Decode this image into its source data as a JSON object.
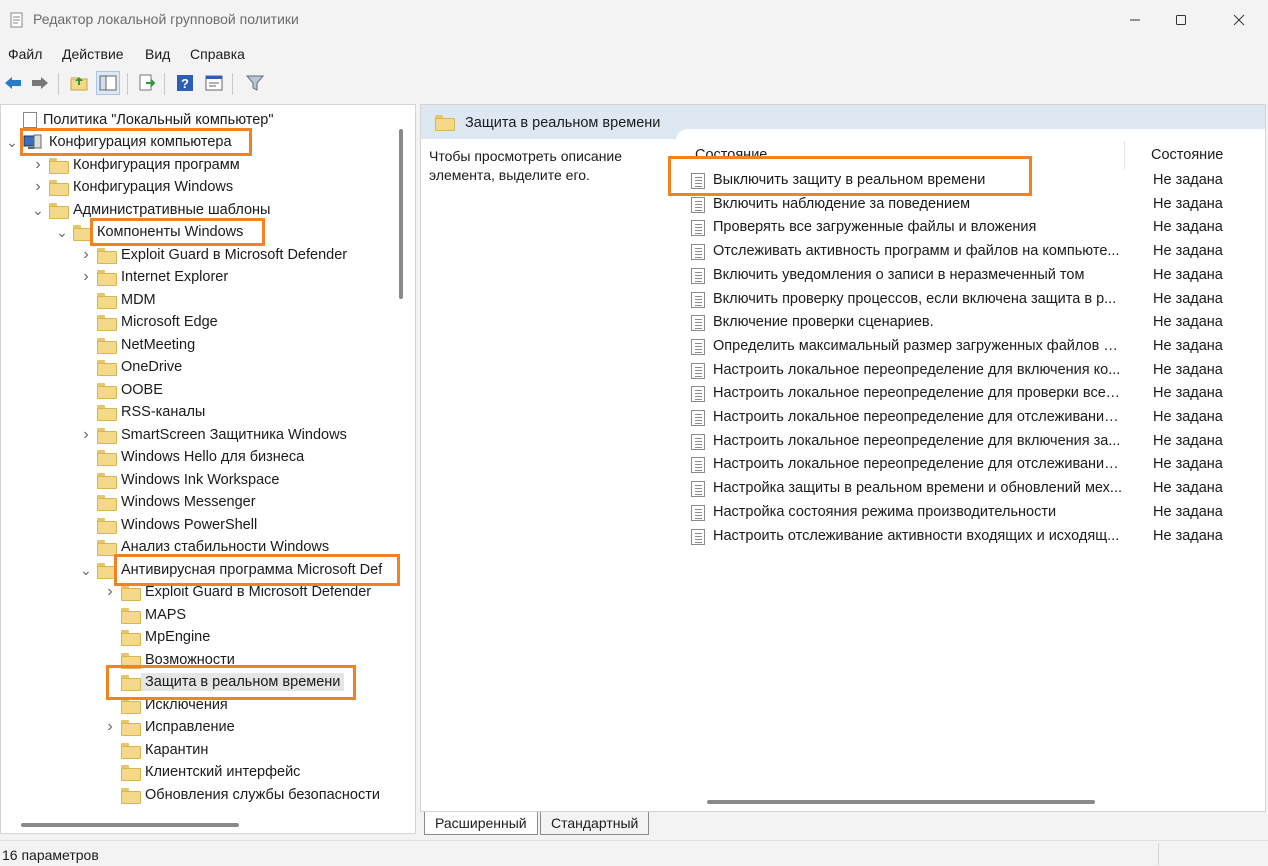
{
  "window": {
    "title": "Редактор локальной групповой политики",
    "controls": [
      "minimize-icon",
      "maximize-icon",
      "close-icon"
    ]
  },
  "menu": {
    "file": "Файл",
    "action": "Действие",
    "view": "Вид",
    "help": "Справка"
  },
  "toolbar": {
    "buttons": [
      "back-icon",
      "forward-icon",
      "up-folder-icon",
      "show-hide-tree-icon",
      "export-list-icon",
      "help-icon",
      "properties-icon",
      "filter-icon"
    ]
  },
  "tree": {
    "items": [
      {
        "label": "Политика \"Локальный компьютер\"",
        "icon": "policy-doc-icon"
      },
      {
        "label": "Конфигурация компьютера",
        "icon": "computer-icon"
      },
      {
        "label": "Конфигурация программ"
      },
      {
        "label": "Конфигурация Windows"
      },
      {
        "label": "Административные шаблоны"
      },
      {
        "label": "Компоненты Windows"
      },
      {
        "label": "Exploit Guard в Microsoft Defender"
      },
      {
        "label": "Internet Explorer"
      },
      {
        "label": "MDM"
      },
      {
        "label": "Microsoft Edge"
      },
      {
        "label": "NetMeeting"
      },
      {
        "label": "OneDrive"
      },
      {
        "label": "OOBE"
      },
      {
        "label": "RSS-каналы"
      },
      {
        "label": "SmartScreen Защитника Windows"
      },
      {
        "label": "Windows Hello для бизнеса"
      },
      {
        "label": "Windows Ink Workspace"
      },
      {
        "label": "Windows Messenger"
      },
      {
        "label": "Windows PowerShell"
      },
      {
        "label": "Анализ стабильности Windows"
      },
      {
        "label": "Антивирусная программа Microsoft Def"
      },
      {
        "label": "Exploit Guard в Microsoft Defender"
      },
      {
        "label": "MAPS"
      },
      {
        "label": "MpEngine"
      },
      {
        "label": "Возможности"
      },
      {
        "label": "Защита в реальном времени"
      },
      {
        "label": "Исключения"
      },
      {
        "label": "Исправление"
      },
      {
        "label": "Карантин"
      },
      {
        "label": "Клиентский интерфейс"
      },
      {
        "label": "Обновления службы безопасности"
      }
    ]
  },
  "content": {
    "header_title": "Защита в реальном времени",
    "description": "Чтобы просмотреть описание элемента, выделите его.",
    "columns": {
      "name": "Состояние",
      "state": "Состояние"
    },
    "rows": [
      {
        "name": "Выключить защиту в реальном времени",
        "state": "Не задана"
      },
      {
        "name": "Включить наблюдение за поведением",
        "state": "Не задана"
      },
      {
        "name": "Проверять все загруженные файлы и вложения",
        "state": "Не задана"
      },
      {
        "name": "Отслеживать активность программ и файлов на компьюте...",
        "state": "Не задана"
      },
      {
        "name": "Включить уведомления о записи в неразмеченный том",
        "state": "Не задана"
      },
      {
        "name": "Включить проверку процессов, если включена защита в р...",
        "state": "Не задана"
      },
      {
        "name": "Включение проверки сценариев.",
        "state": "Не задана"
      },
      {
        "name": "Определить максимальный размер загруженных файлов и...",
        "state": "Не задана"
      },
      {
        "name": "Настроить локальное переопределение для включения ко...",
        "state": "Не задана"
      },
      {
        "name": "Настроить локальное переопределение для проверки всех...",
        "state": "Не задана"
      },
      {
        "name": "Настроить локальное переопределение для отслеживания...",
        "state": "Не задана"
      },
      {
        "name": "Настроить локальное переопределение для включения за...",
        "state": "Не задана"
      },
      {
        "name": "Настроить локальное переопределение для отслеживания...",
        "state": "Не задана"
      },
      {
        "name": "Настройка защиты в реальном времени и обновлений мех...",
        "state": "Не задана"
      },
      {
        "name": "Настройка состояния режима производительности",
        "state": "Не задана"
      },
      {
        "name": "Настроить отслеживание активности входящих и исходящ...",
        "state": "Не задана"
      }
    ]
  },
  "tabs": {
    "extended": "Расширенный",
    "standard": "Стандартный"
  },
  "status": {
    "text": "16 параметров"
  },
  "colors": {
    "highlight": "#f58220",
    "header_bg": "#dde8f3"
  }
}
